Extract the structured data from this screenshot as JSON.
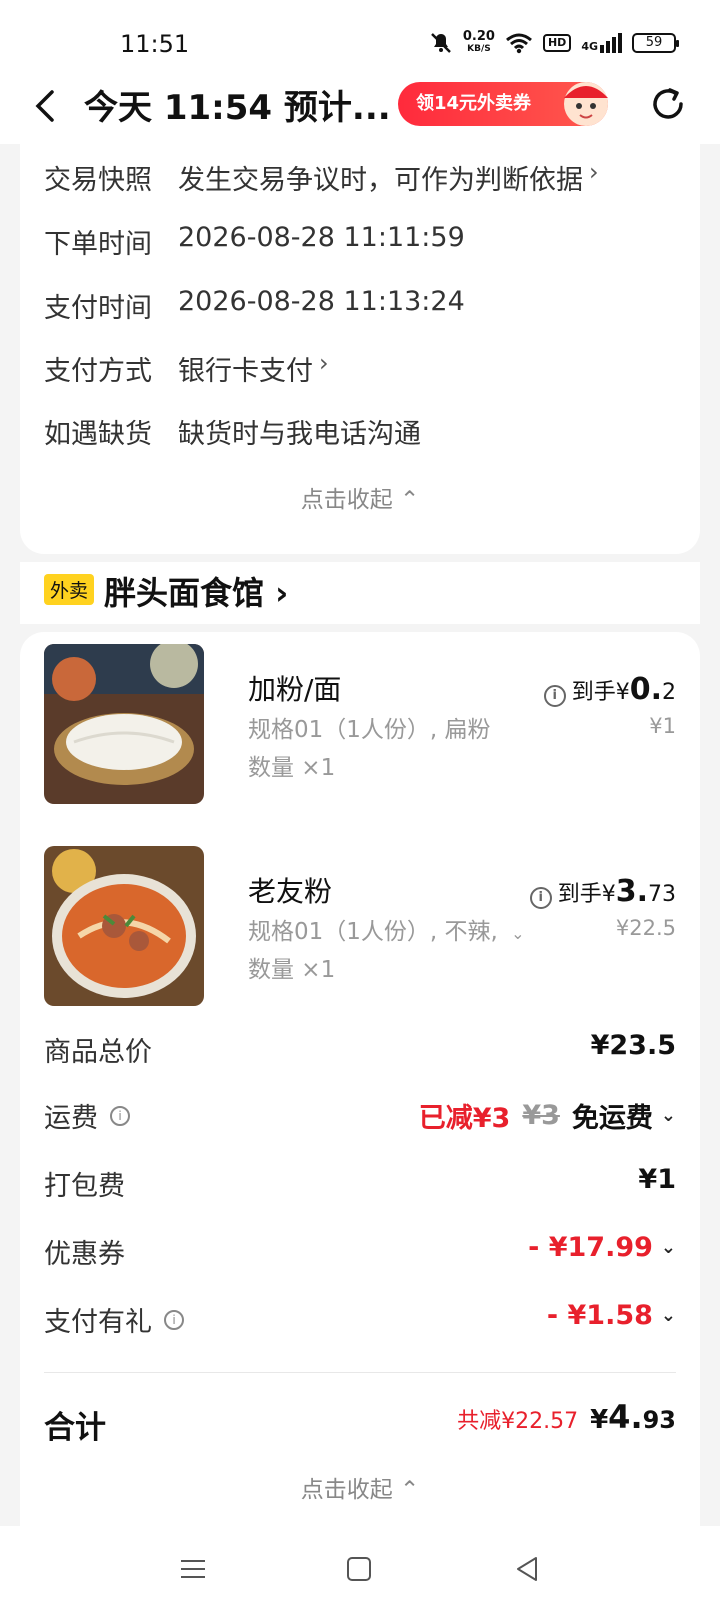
{
  "status_bar": {
    "time": "11:51",
    "net_speed": "0.20",
    "net_unit": "KB/S",
    "hd": "HD",
    "signal": "4G",
    "battery": "59"
  },
  "header": {
    "title": "今天 11:54 预计...",
    "promo_label": "领14元外卖券"
  },
  "order_info": {
    "rows": [
      {
        "label": "交易快照",
        "value": "发生交易争议时，可作为判断依据"
      },
      {
        "label": "下单时间",
        "value": "2026-08-28 11:11:59"
      },
      {
        "label": "支付时间",
        "value": "2026-08-28 11:13:24"
      },
      {
        "label": "支付方式",
        "value": "银行卡支付"
      },
      {
        "label": "如遇缺货",
        "value": "缺货时与我电话沟通"
      }
    ],
    "collapse_label": "点击收起"
  },
  "shop": {
    "tag": "外卖",
    "name": "胖头面食馆"
  },
  "items": [
    {
      "name": "加粉/面",
      "spec": "规格01（1人份）, 扁粉",
      "qty": "数量 ×1",
      "price_prefix": "到手¥",
      "price_int": "0.",
      "price_dec": "2",
      "orig_price": "¥1"
    },
    {
      "name": "老友粉",
      "spec": "规格01（1人份）, 不辣,",
      "qty": "数量 ×1",
      "price_prefix": "到手¥",
      "price_int": "3.",
      "price_dec": "73",
      "orig_price": "¥22.5"
    }
  ],
  "fees": {
    "goods_total_label": "商品总价",
    "goods_total": "¥23.5",
    "shipping_label": "运费",
    "shipping_saved": "已减¥3",
    "shipping_orig": "¥3",
    "shipping_value": "免运费",
    "packing_label": "打包费",
    "packing_value": "¥1",
    "coupon_label": "优惠券",
    "coupon_value": "- ¥17.99",
    "pay_gift_label": "支付有礼",
    "pay_gift_value": "- ¥1.58"
  },
  "total": {
    "label": "合计",
    "saved": "共减¥22.57",
    "currency": "¥",
    "int": "4.",
    "dec": "93"
  },
  "footer_collapse": "点击收起",
  "colors": {
    "accent_red": "#e8202c",
    "tag_yellow": "#ffd21f"
  }
}
